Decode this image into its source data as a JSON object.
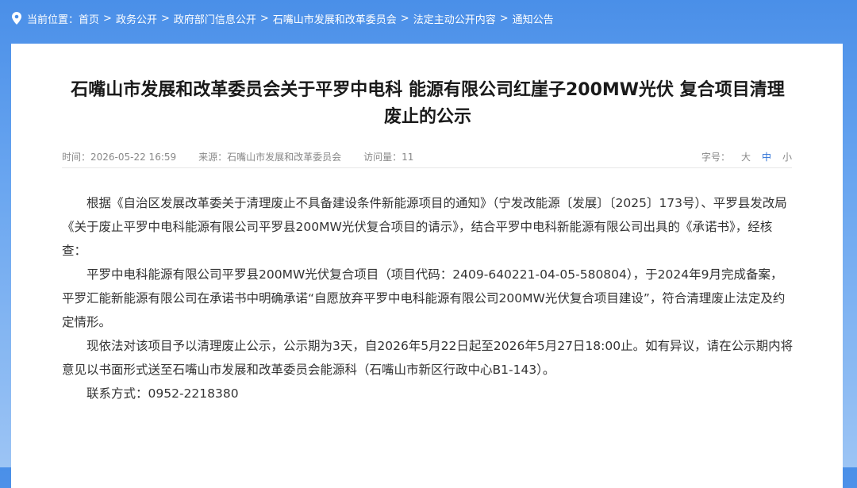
{
  "breadcrumb": {
    "prefix": "当前位置：",
    "items": [
      "首页",
      "政务公开",
      "政府部门信息公开",
      "石嘴山市发展和改革委员会",
      "法定主动公开内容",
      "通知公告"
    ],
    "separator": ">"
  },
  "article": {
    "title": "石嘴山市发展和改革委员会关于平罗中电科 能源有限公司红崖子200MW光伏 复合项目清理废止的公示",
    "meta": {
      "time": "时间：2026-05-22 16:59",
      "source": "来源：石嘴山市发展和改革委员会",
      "visits": "访问量：11"
    },
    "font_size": {
      "label": "字号：",
      "large": "大",
      "medium": "中",
      "small": "小"
    },
    "paragraphs": [
      "根据《自治区发展改革委关于清理废止不具备建设条件新能源项目的通知》（宁发改能源〔发展〕〔2025〕173号）、平罗县发改局《关于废止平罗中电科能源有限公司平罗县200MW光伏复合项目的请示》，结合平罗中电科新能源有限公司出具的《承诺书》，经核查：",
      "平罗中电科能源有限公司平罗县200MW光伏复合项目（项目代码：2409-640221-04-05-580804），于2024年9月完成备案，平罗汇能新能源有限公司在承诺书中明确承诺“自愿放弃平罗中电科能源有限公司200MW光伏复合项目建设”，符合清理废止法定及约定情形。",
      "现依法对该项目予以清理废止公示，公示期为3天，自2026年5月22日起至2026年5月27日18:00止。如有异议，请在公示期内将意见以书面形式送至石嘴山市发展和改革委员会能源科（石嘴山市新区行政中心B1-143）。",
      "联系方式：0952-2218380"
    ]
  },
  "colors": {
    "header_blue": "#4a8fe8",
    "active_font": "#2a6fd6"
  }
}
